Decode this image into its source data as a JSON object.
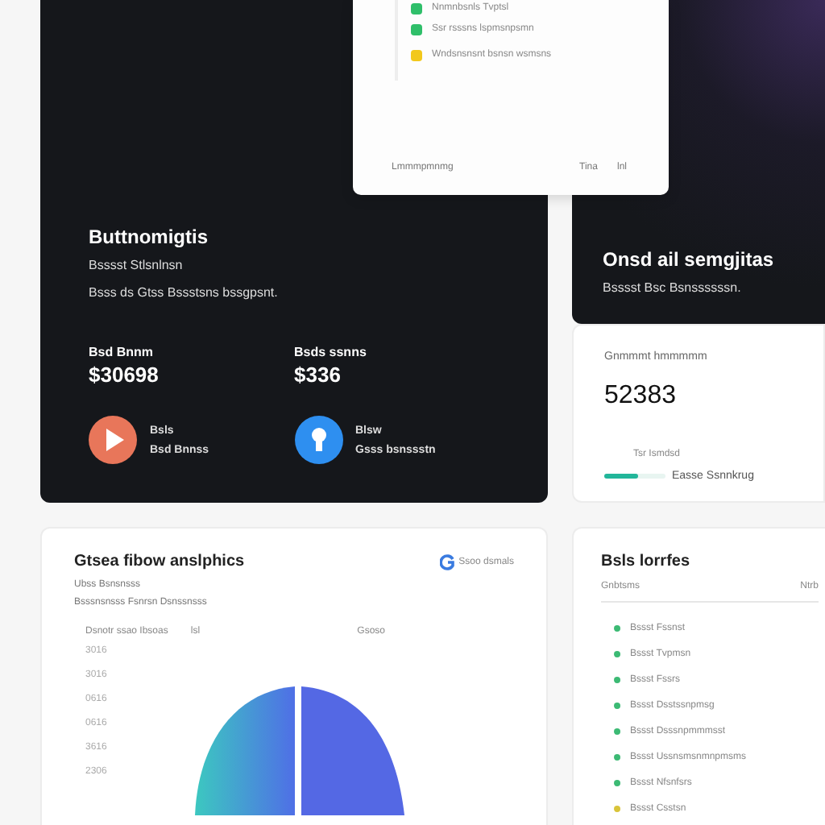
{
  "popup": {
    "items": [
      {
        "label": "Nnmnbsnls Tvptsl",
        "color": "#2fbf6a"
      },
      {
        "label": "Ssr rsssns lspmsnpsmn",
        "color": "#2fbf6a"
      },
      {
        "label": "Wndsnsnsnt bsnsn wsmsns",
        "color": "#f2c81c"
      }
    ],
    "footer_left": "Lmmmpmnmg",
    "footer_right": [
      "Tina",
      "lnl"
    ]
  },
  "hero_card": {
    "title": "Buttnomigtis",
    "subtitle": "Bsssst Stlsnlnsn",
    "description": "Bsss ds Gtss Bssstsns bssgpsnt.",
    "stats": [
      {
        "label": "Bsd Bnnm",
        "value": "$30698",
        "kind": "play",
        "name": "Bsls",
        "caption": "Bsd Bnnss"
      },
      {
        "label": "Bsds ssnns",
        "value": "$336",
        "kind": "bulb",
        "name": "Blsw",
        "caption": "Gsss bsnssstn"
      }
    ]
  },
  "side_card": {
    "title": "Onsd ail semgjitas",
    "subtitle": "Bsssst Bsc Bsnssssssn.",
    "metric_label": "Gnmmmt hmmmmm",
    "metric_value": "52383",
    "note": "Tsr  Ismdsd",
    "progress_label": "Easse Ssnnkrug",
    "level": 0.55
  },
  "analytics_card": {
    "title": "Gtsea fibow anslphics",
    "badge": "Ssoo dsmals",
    "lines": [
      "Ubss Bsnsnsss",
      "Bsssnsnsss Fsnrsn Dsnssnsss"
    ],
    "chart_header": [
      "Dsnotr ssao Ibsoas",
      "lsl",
      "Gsoso"
    ],
    "y_labels": [
      "3016",
      "3016",
      "0616",
      "0616",
      "3616",
      "2306"
    ]
  },
  "list_card": {
    "title": "Bsls lorrfes",
    "columns": [
      "Gnbtsms",
      "Ntrb"
    ],
    "items": [
      {
        "label": "Bssst Fssnst",
        "color": "#3cba74"
      },
      {
        "label": "Bssst Tvpmsn",
        "color": "#3cba74"
      },
      {
        "label": "Bssst Fssrs",
        "color": "#3cba74"
      },
      {
        "label": "Bssst Dsstssnpmsg",
        "color": "#3cba74"
      },
      {
        "label": "Bssst Dsssnpmmmsst",
        "color": "#3cba74"
      },
      {
        "label": "Bssst Ussnsmsnmnpmsms",
        "color": "#3cba74"
      },
      {
        "label": "Bssst Nfsnfsrs",
        "color": "#3cba74"
      },
      {
        "label": "Bssst Csstsn",
        "color": "#d9c43a"
      }
    ]
  }
}
